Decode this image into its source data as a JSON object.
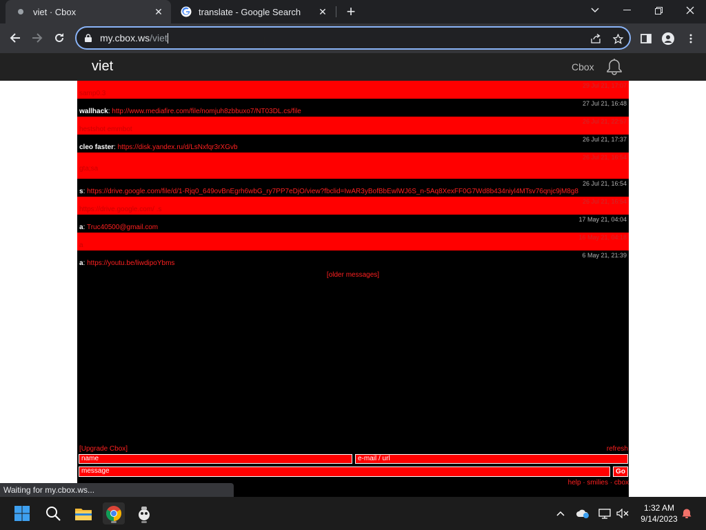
{
  "browser": {
    "tabs": [
      {
        "title": "viet · Cbox",
        "active": true
      },
      {
        "title": "translate - Google Search",
        "active": false
      }
    ],
    "url_host": "my.cbox.ws",
    "url_path": "/viet",
    "status_text": "Waiting for my.cbox.ws..."
  },
  "cbox": {
    "brand": "viet",
    "link_label": "Cbox",
    "messages": [
      {
        "date": "29 Jul 21, 17:07",
        "name": "",
        "text": "samp0.3",
        "style": "red"
      },
      {
        "date": "27 Jul 21, 16:48",
        "name": "wallhack",
        "text": "http://www.mediafire.com/file/nomjuh8zbbuxo7/NT03DL.cs/file",
        "style": "black"
      },
      {
        "date": "26 Jul 21, 22:57",
        "name": "",
        "text": "hestshot emmbot",
        "style": "red"
      },
      {
        "date": "26 Jul 21, 17:37",
        "name": "cleo faster",
        "text": "https://disk.yandex.ru/d/LsNxfqr3rXGvb",
        "style": "black"
      },
      {
        "date": "26 Jul 21, 16:54",
        "name": "",
        "text": "gta;sa",
        "style": "red"
      },
      {
        "date": "26 Jul 21, 16:54",
        "name": "s",
        "text": "https://drive.google.com/file/d/1-Rjq0_649ovBnEgrh6wbG_ry7PP7eDjO/view?fbclid=IwAR3yBofBbEwlWJ6S_n-5Aq8XexFF0G7Wd8b434niyl4MTsv76qnjc9jM8g8",
        "style": "black"
      },
      {
        "date": "26 Jul 21, 16:54",
        "name": "",
        "text": "https://drive.google.com/ .s",
        "style": "red"
      },
      {
        "date": "17 May 21, 04:04",
        "name": "a",
        "text": "Truc40500@gmail.com",
        "style": "black"
      },
      {
        "date": "16 May 21, 04:18",
        "name": "",
        "text": "a",
        "style": "red"
      },
      {
        "date": "6 May 21, 21:39",
        "name": "a",
        "text": "https://youtu.be/liwdipoYbms",
        "style": "black"
      }
    ],
    "older_label": "[older messages]",
    "upgrade_label": "[Upgrade Cbox]",
    "refresh_label": "refresh",
    "name_placeholder": "name",
    "email_placeholder": "e-mail / url",
    "message_placeholder": "message",
    "go_label": "Go",
    "footer_links": "help · smilies · cbox"
  },
  "taskbar": {
    "time": "1:32 AM",
    "date": "9/14/2023"
  },
  "colors": {
    "accent": "#ff0000",
    "omnibox_focus": "#8ab4f8"
  }
}
